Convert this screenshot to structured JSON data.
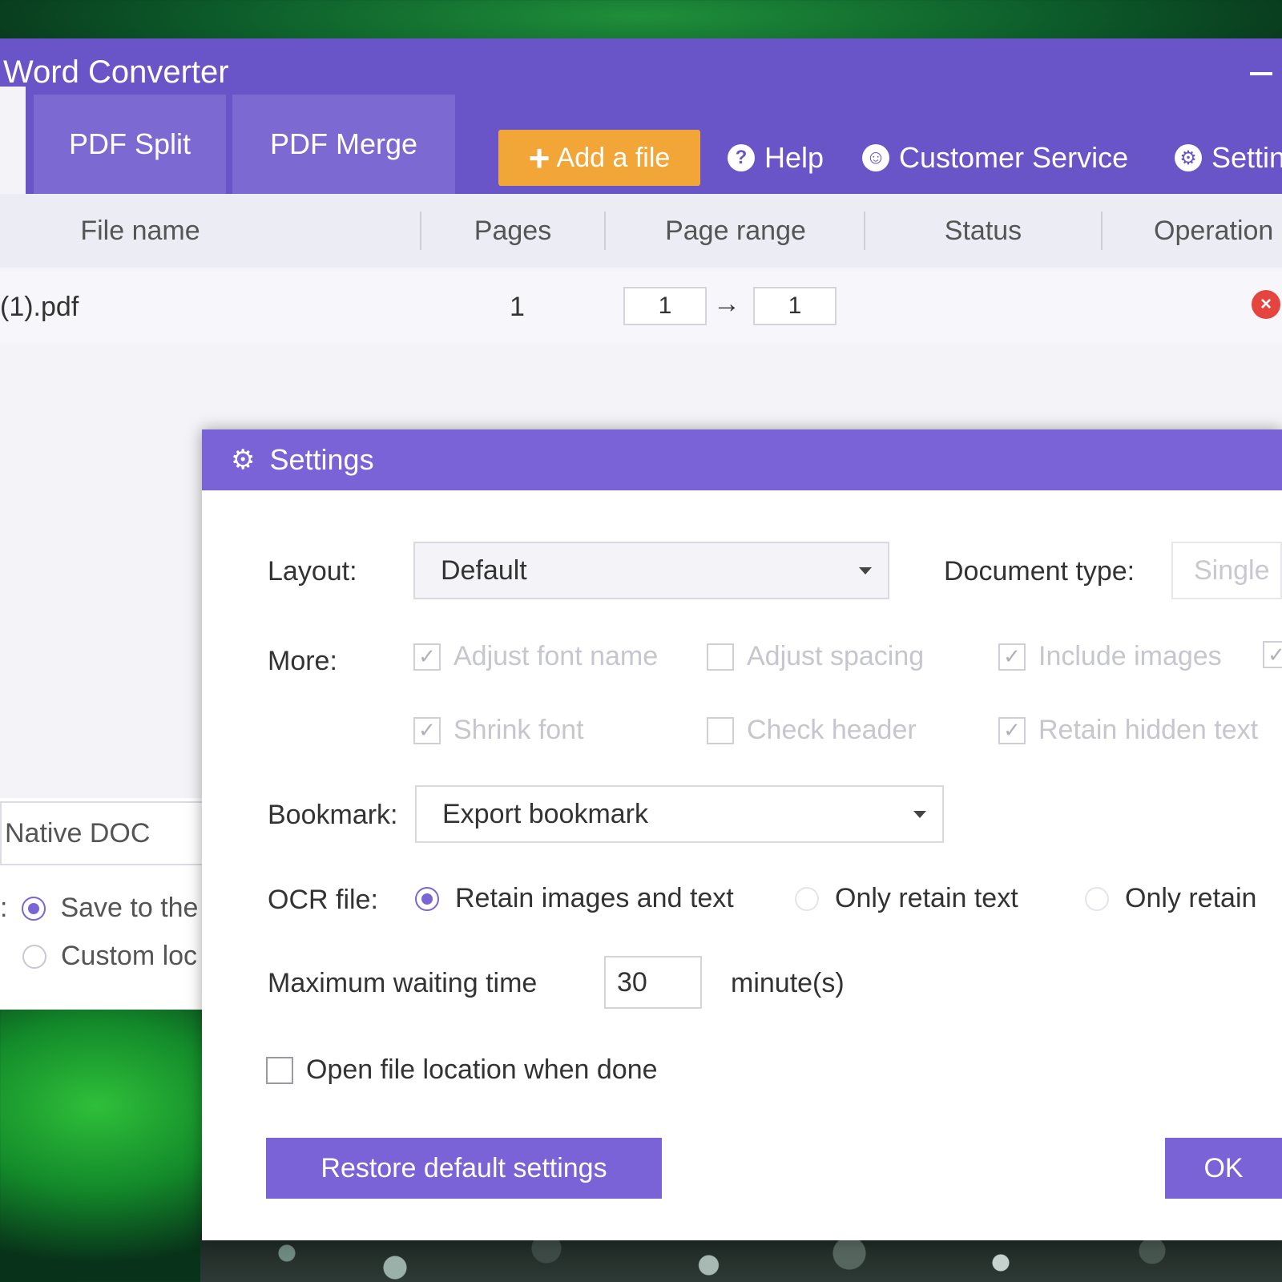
{
  "window": {
    "title": "Word Converter",
    "tabs": [
      {
        "label": "PDF Split"
      },
      {
        "label": "PDF Merge"
      }
    ],
    "toolbar": {
      "add_file": "Add a file",
      "help": "Help",
      "customer_service": "Customer Service",
      "settings": "Settin"
    }
  },
  "table": {
    "headers": [
      "File name",
      "Pages",
      "Page range",
      "Status",
      "Operation"
    ],
    "rows": [
      {
        "file_name": "(1).pdf",
        "pages": "1",
        "range_from": "1",
        "range_to": "1"
      }
    ]
  },
  "output": {
    "format": "Native DOC",
    "options": [
      {
        "label": "Save to the",
        "selected": true
      },
      {
        "label": "Custom loc",
        "selected": false
      }
    ]
  },
  "settings_dialog": {
    "title": "Settings",
    "layout_label": "Layout:",
    "layout_value": "Default",
    "doc_type_label": "Document type:",
    "doc_type_value": "Single",
    "more_label": "More:",
    "checkboxes": [
      {
        "label": "Adjust font name",
        "checked": true
      },
      {
        "label": "Adjust spacing",
        "checked": false
      },
      {
        "label": "Include images",
        "checked": true
      },
      {
        "label": "Shrink font",
        "checked": true
      },
      {
        "label": "Check header",
        "checked": false
      },
      {
        "label": "Retain hidden text",
        "checked": true
      }
    ],
    "bookmark_label": "Bookmark:",
    "bookmark_value": "Export bookmark",
    "ocr_label": "OCR file:",
    "ocr_options": [
      {
        "label": "Retain images and text",
        "selected": true
      },
      {
        "label": "Only retain text",
        "selected": false
      },
      {
        "label": "Only retain",
        "selected": false
      }
    ],
    "wait_label": "Maximum waiting time",
    "wait_value": "30",
    "wait_unit": "minute(s)",
    "open_location_label": "Open file location when done",
    "open_location_checked": false,
    "restore_button": "Restore default settings",
    "ok_button": "OK"
  },
  "colors": {
    "accent": "#6a55c8",
    "add_button": "#f2a637",
    "delete": "#e5443f"
  }
}
